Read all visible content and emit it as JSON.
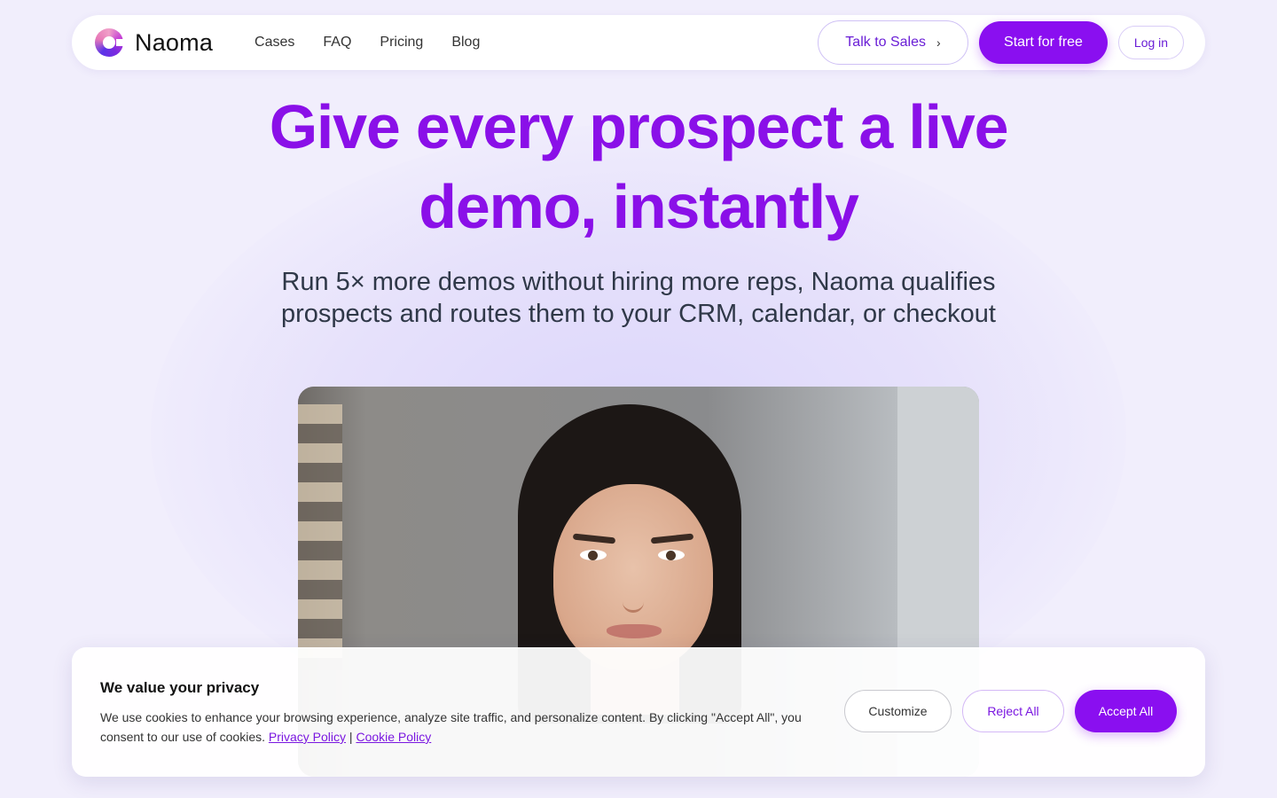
{
  "nav": {
    "brand": "Naoma",
    "links": [
      "Cases",
      "FAQ",
      "Pricing",
      "Blog"
    ],
    "talk_to_sales": "Talk to Sales",
    "start_for_free": "Start for free",
    "log_in": "Log in"
  },
  "hero": {
    "headline_line1": "Give every prospect a live",
    "headline_line2": "demo, instantly",
    "subtitle_line1": "Run 5× more demos without hiring more reps, Naoma qualifies",
    "subtitle_line2": "prospects and routes them to your CRM, calendar, or checkout"
  },
  "cookie": {
    "title": "We value your privacy",
    "text": "We use cookies to enhance your browsing experience, analyze site traffic, and personalize content. By clicking \"Accept All\", you consent to our use of cookies.",
    "privacy_policy": "Privacy Policy",
    "separator": "|",
    "cookie_policy": "Cookie Policy",
    "customize": "Customize",
    "reject_all": "Reject All",
    "accept_all": "Accept All"
  },
  "colors": {
    "brand_purple": "#8a0ff0",
    "headline_purple": "#8a10e8",
    "background": "#f1eefc"
  },
  "icons": {
    "logo": "naoma-logo-icon",
    "talk_chevron": "chevron-right-icon"
  }
}
